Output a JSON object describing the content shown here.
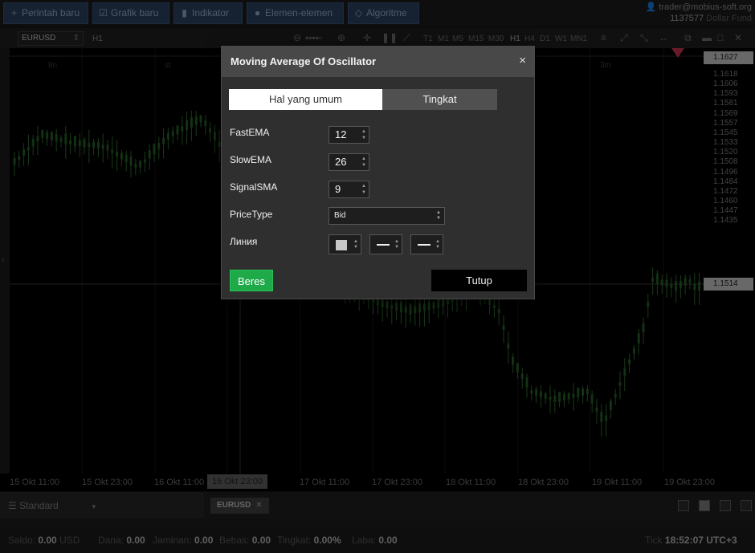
{
  "toolbar": {
    "new_order": "Perintah baru",
    "new_chart": "Grafik baru",
    "indicators": "Indikator",
    "elements": "Elemen-elemen",
    "algorithms": "Algoritme"
  },
  "user": {
    "email": "trader@mobius-soft.org",
    "account": "1137577",
    "fund": "Dollar Fund"
  },
  "chart_header": {
    "symbol": "EURUSD",
    "timeframe": "H1",
    "timeframes": [
      "T1",
      "M1",
      "M5",
      "M15",
      "M30",
      "H1",
      "H4",
      "D1",
      "W1",
      "MN1"
    ]
  },
  "chart_top_labels": [
    "8n",
    "st",
    "3m"
  ],
  "price_axis": {
    "labels": [
      "1.1618",
      "1.1606",
      "1.1593",
      "1.1581",
      "1.1569",
      "1.1557",
      "1.1545",
      "1.1533",
      "1.1520",
      "1.1508",
      "1.1496",
      "1.1484",
      "1.1472",
      "1.1460",
      "1.1447",
      "1.1435"
    ],
    "top_tag": "1.1627",
    "current_tag": "1.1514"
  },
  "time_axis": {
    "labels": [
      "15 Okt 11:00",
      "15 Okt 23:00",
      "16 Okt 11:00",
      "17 Okt 11:00",
      "17 Okt 23:00",
      "18 Okt 11:00",
      "18 Okt 23:00",
      "19 Okt 11:00",
      "19 Okt 23:00"
    ],
    "cursor": "16 Okt 23:00"
  },
  "bottom": {
    "layout_select": "Standard",
    "chart_tab": "EURUSD"
  },
  "status": {
    "balance_label": "Saldo:",
    "balance_value": "0.00",
    "currency": "USD",
    "funds_label": "Dana:",
    "funds_value": "0.00",
    "margin_label": "Jaminan:",
    "margin_value": "0.00",
    "free_label": "Bebas:",
    "free_value": "0.00",
    "level_label": "Tingkat:",
    "level_value": "0.00%",
    "profit_label": "Laba:",
    "profit_value": "0.00",
    "tick_label": "Tick",
    "time": "18:52:07",
    "timezone": "UTC+3"
  },
  "dialog": {
    "title": "Moving Average Of Oscillator",
    "close_icon": "×",
    "tabs": [
      "Hal yang umum",
      "Tingkat"
    ],
    "params": {
      "fast_label": "FastEMA",
      "fast_value": "12",
      "slow_label": "SlowEMA",
      "slow_value": "26",
      "signal_label": "SignalSMA",
      "signal_value": "9",
      "price_label": "PriceType",
      "price_value": "Bid",
      "line_label": "Линия"
    },
    "ok": "Beres",
    "close": "Tutup"
  },
  "colors": {
    "toolbar_button": "#283e5c",
    "ok_button": "#1faa4a",
    "candle": "#2e6b2e"
  }
}
